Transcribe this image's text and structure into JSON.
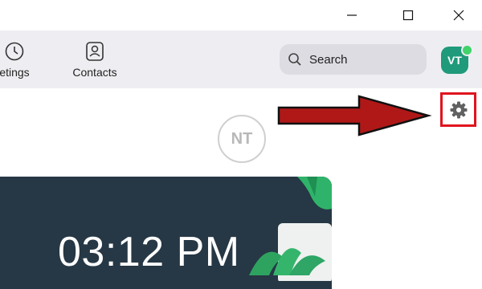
{
  "window": {
    "controls": [
      "minimize",
      "maximize",
      "close"
    ]
  },
  "nav": {
    "items": [
      {
        "label": "etings",
        "icon": "clock-icon"
      },
      {
        "label": "Contacts",
        "icon": "contact-card-icon"
      }
    ]
  },
  "search": {
    "label": "Search",
    "icon": "search-icon"
  },
  "profile": {
    "initials": "VT",
    "status": "online",
    "color": "#1f9a7a"
  },
  "settings": {
    "icon": "gear-icon",
    "highlight_color": "#e0141e"
  },
  "annotation": {
    "icon": "arrow-right-icon",
    "color": "#b01818"
  },
  "watermark": {
    "text": "NT"
  },
  "hero": {
    "time": "03:12 PM",
    "background": "#263745"
  }
}
